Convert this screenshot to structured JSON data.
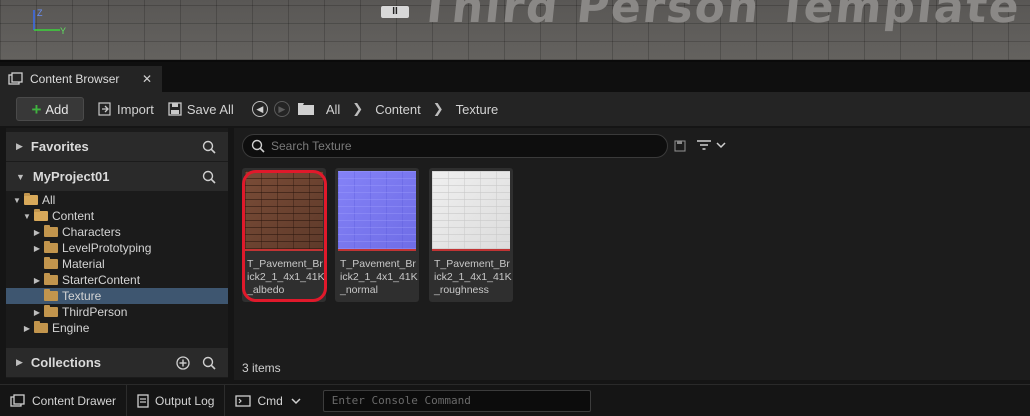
{
  "viewport": {
    "overlay_text": "Third Person Template",
    "pause_label": "II",
    "axis_labels": {
      "z": "Z",
      "y": "Y"
    }
  },
  "tab": {
    "label": "Content Browser",
    "close": "✕"
  },
  "toolbar": {
    "add_label": "Add",
    "import_label": "Import",
    "save_all_label": "Save All",
    "breadcrumb": [
      "All",
      "Content",
      "Texture"
    ]
  },
  "sidebar": {
    "favorites_label": "Favorites",
    "project_label": "MyProject01",
    "collections_label": "Collections",
    "tree": [
      {
        "label": "All",
        "depth": 0,
        "expanded": true,
        "selected": false
      },
      {
        "label": "Content",
        "depth": 1,
        "expanded": true,
        "selected": false
      },
      {
        "label": "Characters",
        "depth": 2,
        "expanded": false,
        "selected": false
      },
      {
        "label": "LevelPrototyping",
        "depth": 2,
        "expanded": false,
        "selected": false
      },
      {
        "label": "Material",
        "depth": 2,
        "expanded": null,
        "selected": false
      },
      {
        "label": "StarterContent",
        "depth": 2,
        "expanded": false,
        "selected": false
      },
      {
        "label": "Texture",
        "depth": 2,
        "expanded": null,
        "selected": true
      },
      {
        "label": "ThirdPerson",
        "depth": 2,
        "expanded": false,
        "selected": false
      },
      {
        "label": "Engine",
        "depth": 1,
        "expanded": false,
        "selected": false
      }
    ]
  },
  "content": {
    "search_placeholder": "Search Texture",
    "assets": [
      {
        "name": "T_Pavement_Brick2_1_4x1_41K_albedo",
        "type": "albedo",
        "highlighted": true
      },
      {
        "name": "T_Pavement_Brick2_1_4x1_41K_normal",
        "type": "normal",
        "highlighted": false
      },
      {
        "name": "T_Pavement_Brick2_1_4x1_41K_roughness",
        "type": "rough",
        "highlighted": false
      }
    ],
    "item_count": "3 items"
  },
  "bottom_bar": {
    "content_drawer_label": "Content Drawer",
    "output_log_label": "Output Log",
    "cmd_label": "Cmd",
    "console_placeholder": "Enter Console Command"
  },
  "colors": {
    "accent_add": "#3fb33f",
    "selection": "#3e5670",
    "highlight_ring": "#e0192b",
    "folder": "#c2954d"
  }
}
